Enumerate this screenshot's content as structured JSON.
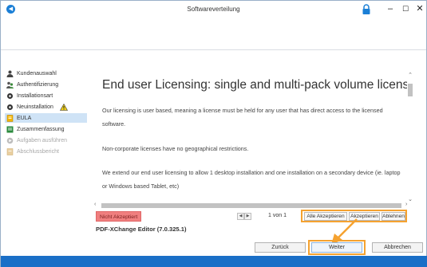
{
  "window": {
    "title": "Softwareverteilung",
    "icons": [
      "app-icon",
      "lock-icon",
      "minimize-icon",
      "maximize-icon",
      "close-icon"
    ],
    "controls": {
      "minimize": "–",
      "maximize": "☐",
      "close": "✕"
    }
  },
  "sidebar": {
    "items": [
      {
        "label": "Kundenauswahl",
        "icon": "person-icon",
        "state": "normal"
      },
      {
        "label": "Authentifizierung",
        "icon": "people-icon",
        "state": "normal"
      },
      {
        "label": "Installationsart",
        "icon": "gear-icon",
        "state": "normal"
      },
      {
        "label": "Neuinstallation",
        "icon": "gear-icon",
        "state": "warning"
      },
      {
        "label": "EULA",
        "icon": "document-icon",
        "state": "active"
      },
      {
        "label": "Zusammenfassung",
        "icon": "summary-icon",
        "state": "normal"
      },
      {
        "label": "Aufgaben ausführen",
        "icon": "run-icon",
        "state": "disabled"
      },
      {
        "label": "Abschlussbericht",
        "icon": "report-icon",
        "state": "disabled"
      }
    ]
  },
  "eula": {
    "title": "End user Licensing: single and multi-pack volume licenses",
    "paragraphs": [
      "Our licensing is user based, meaning a license must be held for any user that has direct access to the licensed software.",
      "Non-corporate licenses have no geographical restrictions.",
      "We extend our end user licensing to allow 1 desktop installation and one installation on a secondary device (ie. laptop or Windows based Tablet, etc)"
    ]
  },
  "status": {
    "badge": "Nicht Akzeptiert",
    "page_indicator": "1 von 1",
    "prev_glyph": "◀",
    "next_glyph": "▶"
  },
  "accept_actions": {
    "accept_all": "Alle Akzeptieren",
    "accept": "Akzeptieren",
    "decline": "Ablehnen"
  },
  "product": "PDF-XChange Editor (7.0.325.1)",
  "nav": {
    "back": "Zurück",
    "next": "Weiter",
    "cancel": "Abbrechen"
  },
  "colors": {
    "accent": "#1a6fc7",
    "highlight": "#f5a230",
    "badge": "#f07f7f",
    "active_item": "#cfe3f6"
  }
}
